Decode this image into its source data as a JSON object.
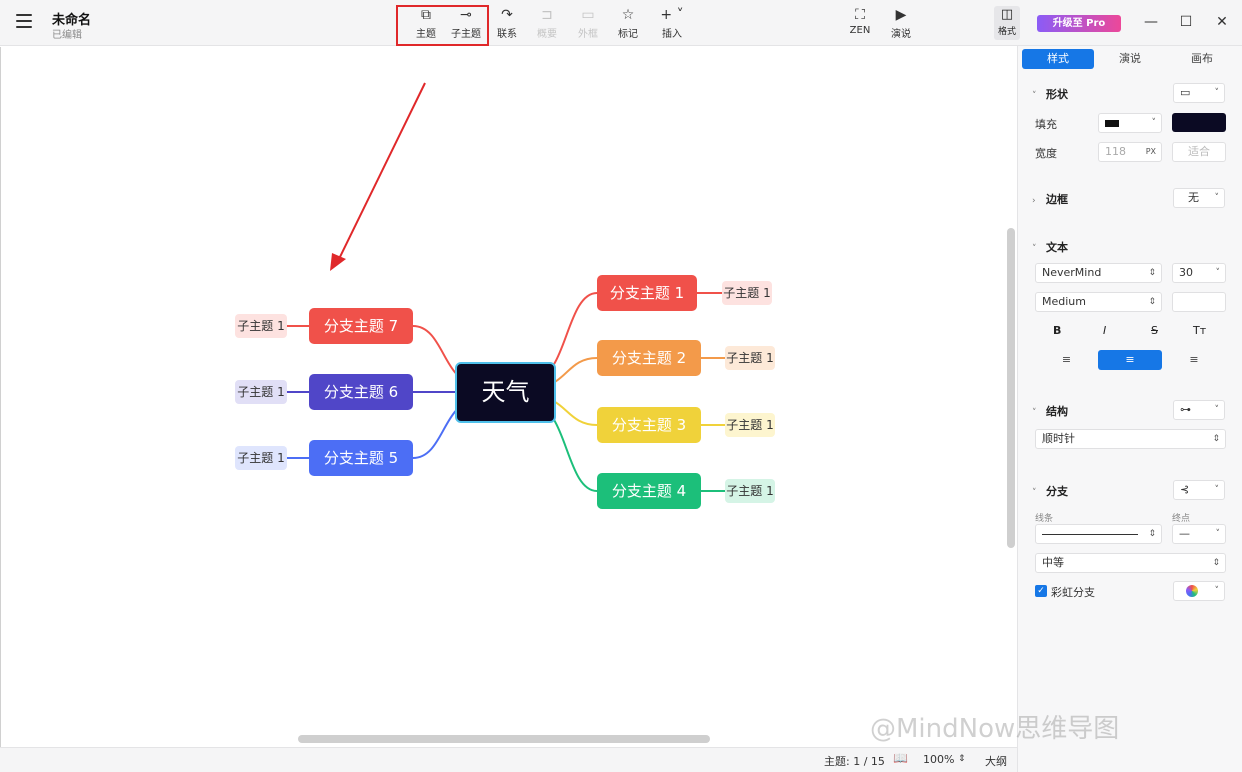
{
  "header": {
    "title": "未命名",
    "status": "已编辑",
    "tools": [
      {
        "label": "主题",
        "icon": "topic-icon",
        "glyph": "⧉"
      },
      {
        "label": "子主题",
        "icon": "subtopic-icon",
        "glyph": "⊸"
      },
      {
        "label": "联系",
        "icon": "relation-icon",
        "glyph": "↷"
      },
      {
        "label": "概要",
        "icon": "summary-icon",
        "glyph": "⊐"
      },
      {
        "label": "外框",
        "icon": "boundary-icon",
        "glyph": "▭"
      },
      {
        "label": "标记",
        "icon": "star-icon",
        "glyph": "☆"
      },
      {
        "label": "插入",
        "icon": "plus-icon",
        "glyph": "+ ˅"
      }
    ],
    "zen_label": "ZEN",
    "present_label": "演说",
    "format_label": "格式",
    "pro_label": "升级至 Pro"
  },
  "mindmap": {
    "center": "天气",
    "branches": [
      {
        "label": "分支主题 1",
        "child": "子主题 1",
        "color": "#f0514a",
        "light": "#fde2e0"
      },
      {
        "label": "分支主题 2",
        "child": "子主题 1",
        "color": "#f39a4a",
        "light": "#fde9d8"
      },
      {
        "label": "分支主题 3",
        "child": "子主题 1",
        "color": "#f0d23a",
        "light": "#fdf5cf"
      },
      {
        "label": "分支主题 4",
        "child": "子主题 1",
        "color": "#1cbf7a",
        "light": "#d5f4e6"
      },
      {
        "label": "分支主题 5",
        "child": "子主题 1",
        "color": "#4c6ef5",
        "light": "#dfe5fd"
      },
      {
        "label": "分支主题 6",
        "child": "子主题 1",
        "color": "#5046c8",
        "light": "#e1dff6"
      },
      {
        "label": "分支主题 7",
        "child": "子主题 1",
        "color": "#f0514a",
        "light": "#fde2e0"
      }
    ]
  },
  "statusbar": {
    "topic_count": "主题: 1 / 15",
    "zoom": "100%",
    "outline_label": "大纲"
  },
  "panel": {
    "tabs": [
      "样式",
      "演说",
      "画布"
    ],
    "shape": {
      "title": "形状",
      "fill_label": "填充",
      "fill_color": "#0b0a23",
      "width_label": "宽度",
      "width_value": "118",
      "width_unit": "PX",
      "fit_label": "适合"
    },
    "border": {
      "title": "边框",
      "value": "无"
    },
    "text": {
      "title": "文本",
      "font": "NeverMind",
      "size": "30",
      "weight": "Medium",
      "bold": "B",
      "italic": "I",
      "strike": "S",
      "case": "Tт"
    },
    "structure": {
      "title": "结构",
      "value": "顺时针"
    },
    "branch": {
      "title": "分支",
      "line_label": "线条",
      "end_label": "终点",
      "thickness": "中等",
      "rainbow_label": "彩虹分支"
    }
  },
  "watermark": "@MindNow思维导图"
}
